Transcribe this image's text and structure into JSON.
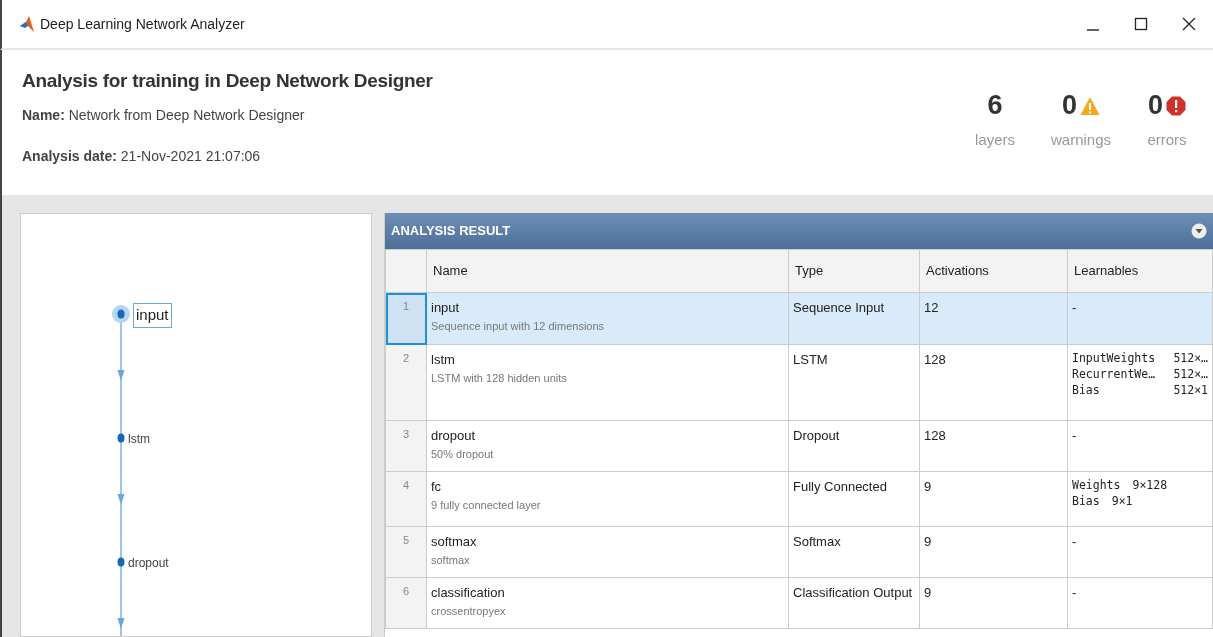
{
  "window": {
    "title": "Deep Learning Network Analyzer"
  },
  "header": {
    "title": "Analysis for training in Deep Network Designer",
    "fields": [
      {
        "label": "Name:",
        "value": "Network from Deep Network Designer"
      },
      {
        "label": "Analysis date:",
        "value": "21-Nov-2021 21:07:06"
      }
    ]
  },
  "stats": [
    {
      "kind": "plain",
      "value": "6",
      "label": "layers"
    },
    {
      "kind": "warning",
      "value": "0",
      "label": "warnings"
    },
    {
      "kind": "error",
      "value": "0",
      "label": "errors"
    }
  ],
  "graph": {
    "nodes": [
      {
        "label": "input",
        "selected": true
      },
      {
        "label": "lstm",
        "selected": false
      },
      {
        "label": "dropout",
        "selected": false
      }
    ]
  },
  "table": {
    "title": "ANALYSIS RESULT",
    "columns": [
      "Name",
      "Type",
      "Activations",
      "Learnables"
    ],
    "rows": [
      {
        "index": "1",
        "name": "input",
        "description": "Sequence input with 12 dimensions",
        "type": "Sequence Input",
        "activations": "12",
        "learnables": [
          {
            "name": "-"
          }
        ],
        "selected": true
      },
      {
        "index": "2",
        "name": "lstm",
        "description": "LSTM with 128 hidden units",
        "type": "LSTM",
        "activations": "128",
        "learnables": [
          {
            "name": "InputWeights",
            "value": "512×…"
          },
          {
            "name": "RecurrentWe…",
            "value": "512×…"
          },
          {
            "name": "Bias",
            "value": "512×1"
          }
        ],
        "selected": false
      },
      {
        "index": "3",
        "name": "dropout",
        "description": "50% dropout",
        "type": "Dropout",
        "activations": "128",
        "learnables": [
          {
            "name": "-"
          }
        ],
        "selected": false
      },
      {
        "index": "4",
        "name": "fc",
        "description": "9 fully connected layer",
        "type": "Fully Connected",
        "activations": "9",
        "learnables": [
          {
            "name": "Weights",
            "value": "9×128"
          },
          {
            "name": "Bias",
            "value": "9×1"
          }
        ],
        "selected": false
      },
      {
        "index": "5",
        "name": "softmax",
        "description": "softmax",
        "type": "Softmax",
        "activations": "9",
        "learnables": [
          {
            "name": "-"
          }
        ],
        "selected": false
      },
      {
        "index": "6",
        "name": "classification",
        "description": "crossentropyex",
        "type": "Classification Output",
        "activations": "9",
        "learnables": [
          {
            "name": "-"
          }
        ],
        "selected": false
      }
    ]
  }
}
